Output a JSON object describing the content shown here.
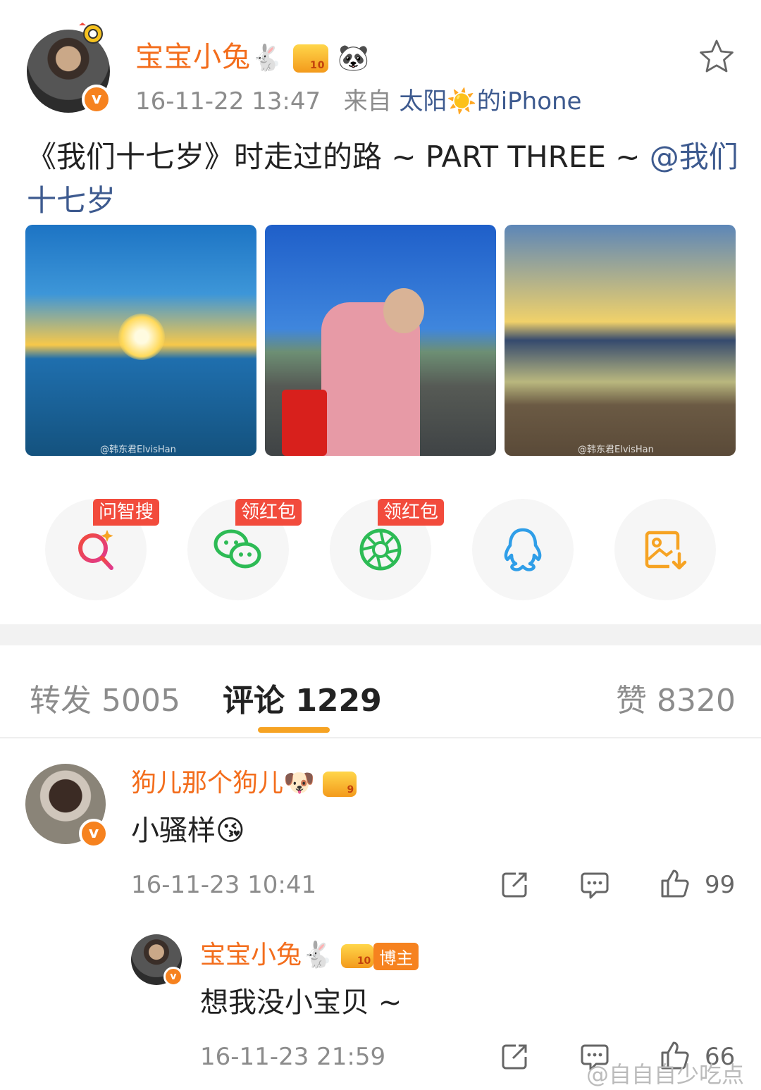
{
  "post": {
    "author": "宝宝小兔",
    "author_emoji": "🐇",
    "author_emoji2": "🐼",
    "level_badge": "10",
    "verified": "v",
    "timestamp": "16-11-22 13:47",
    "source_prefix": "来自",
    "source": "太阳☀️的iPhone",
    "text": "《我们十七岁》时走过的路 ~ PART THREE ~ ",
    "mention": "@我们十七岁",
    "images": [
      {
        "watermark": "@韩东君ElvisHan"
      },
      {
        "watermark": ""
      },
      {
        "watermark": "@韩东君ElvisHan"
      }
    ]
  },
  "share": {
    "items": [
      {
        "tag": "问智搜",
        "icon": "ai-search-icon",
        "color": "#f24b3c"
      },
      {
        "tag": "领红包",
        "icon": "wechat-icon",
        "color": "#2dbb55"
      },
      {
        "tag": "领红包",
        "icon": "moments-icon",
        "color": "#2dbb55"
      },
      {
        "tag": "",
        "icon": "qq-icon",
        "color": "#2f9ee8"
      },
      {
        "tag": "",
        "icon": "save-image-icon",
        "color": "#f6a323"
      }
    ]
  },
  "tabs": {
    "repost": "转发 5005",
    "comments": "评论 1229",
    "likes": "赞 8320"
  },
  "comments": [
    {
      "name": "狗儿那个狗儿",
      "name_emoji": "🐶",
      "level_badge": "9",
      "verified": "v",
      "text": "小骚样",
      "text_emoji": "😘",
      "time": "16-11-23 10:41",
      "likes": "99"
    }
  ],
  "reply": {
    "name": "宝宝小兔",
    "name_emoji": "🐇",
    "level_badge": "10",
    "blogger_tag": "博主",
    "verified": "v",
    "text": "想我没小宝贝 ~",
    "time": "16-11-23 21:59",
    "likes": "66"
  },
  "watermark": "@自自自少吃点"
}
